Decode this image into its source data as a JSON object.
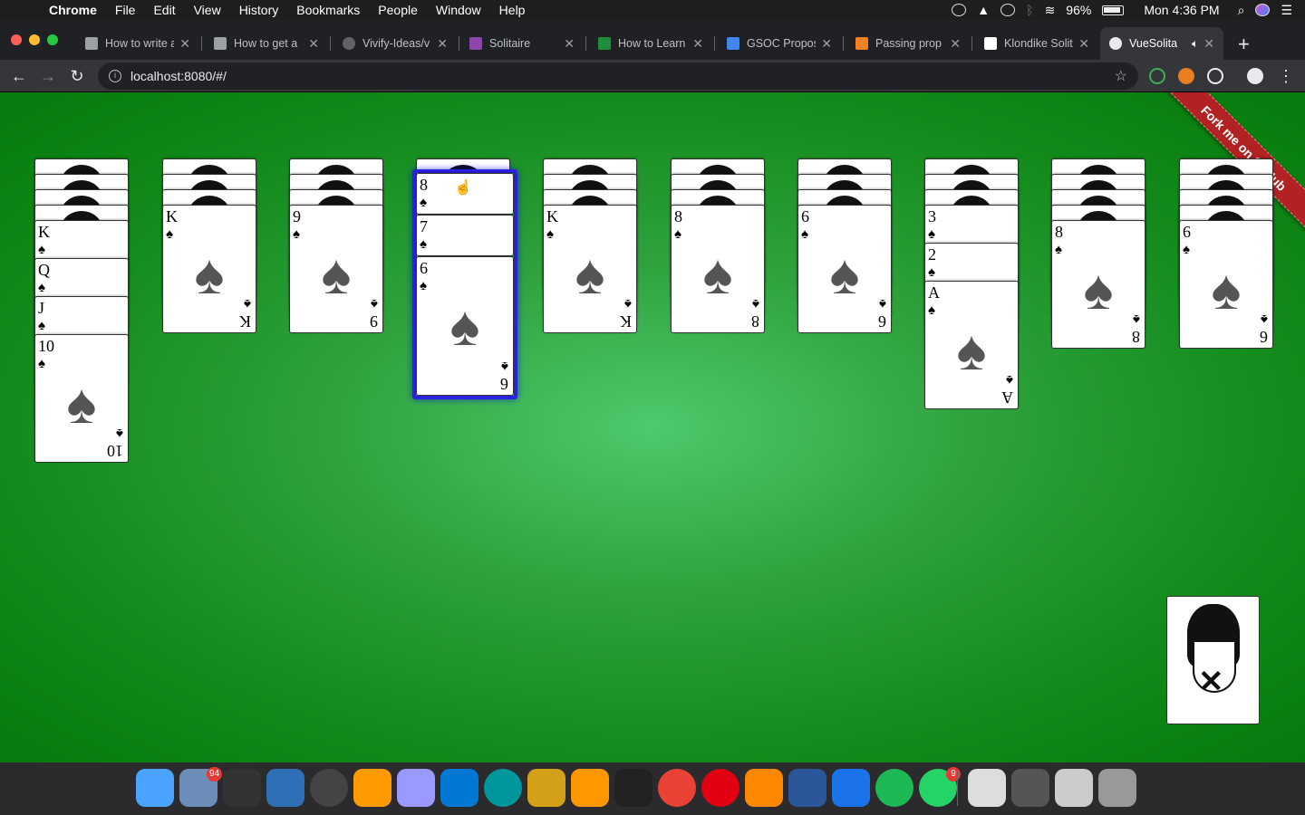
{
  "menubar": {
    "app_name": "Chrome",
    "items": [
      "File",
      "Edit",
      "View",
      "History",
      "Bookmarks",
      "People",
      "Window",
      "Help"
    ],
    "battery": "96%",
    "clock": "Mon 4:36 PM"
  },
  "tabs": [
    {
      "title": "How to write a",
      "icon": "page-icon"
    },
    {
      "title": "How to get a",
      "icon": "page-icon"
    },
    {
      "title": "Vivify-Ideas/v",
      "icon": "github-icon"
    },
    {
      "title": "Solitaire",
      "icon": "solitaire-icon"
    },
    {
      "title": "How to Learn",
      "icon": "page-icon"
    },
    {
      "title": "GSOC Propos",
      "icon": "docs-icon"
    },
    {
      "title": "Passing prop",
      "icon": "stackoverflow-icon"
    },
    {
      "title": "Klondike Solit",
      "icon": "page-icon"
    },
    {
      "title": "VueSolita",
      "icon": "vue-icon",
      "active": true
    }
  ],
  "toolbar": {
    "url": "localhost:8080/#/"
  },
  "game": {
    "ribbon_text": "Fork me on GitHub",
    "suit_symbol": "♠",
    "piles": [
      {
        "hidden": 4,
        "visible": [
          "K",
          "Q",
          "J",
          "10"
        ]
      },
      {
        "hidden": 3,
        "visible": [
          "K"
        ]
      },
      {
        "hidden": 3,
        "visible": [
          "9"
        ]
      },
      {
        "hidden": 3,
        "visible": [],
        "selected": [
          "8",
          "7",
          "6"
        ]
      },
      {
        "hidden": 3,
        "visible": [
          "K"
        ]
      },
      {
        "hidden": 3,
        "visible": [
          "8"
        ]
      },
      {
        "hidden": 3,
        "visible": [
          "6"
        ]
      },
      {
        "hidden": 3,
        "visible": [
          "3",
          "2",
          "A"
        ]
      },
      {
        "hidden": 4,
        "visible": [
          "8"
        ]
      },
      {
        "hidden": 4,
        "visible": [
          "6"
        ]
      }
    ]
  },
  "dock": {
    "apps": [
      "Finder",
      "Mail",
      "Activity Monitor",
      "MySQL Workbench",
      "OBS",
      "Ai",
      "Ae",
      "Visual Studio Code",
      "Arduino",
      "Teapot",
      "Sublime Text",
      "Terminal",
      "Chrome",
      "Opera",
      "VLC",
      "Word",
      "QuickTime",
      "Spotify",
      "WhatsApp",
      "iTunes",
      "Keyboard",
      "Preview",
      "Trash"
    ],
    "mail_badge": "94",
    "whatsapp_badge": "9"
  },
  "colors": {
    "felt": "#138a1b",
    "selection": "#2a22e0",
    "ribbon": "#b22222"
  }
}
